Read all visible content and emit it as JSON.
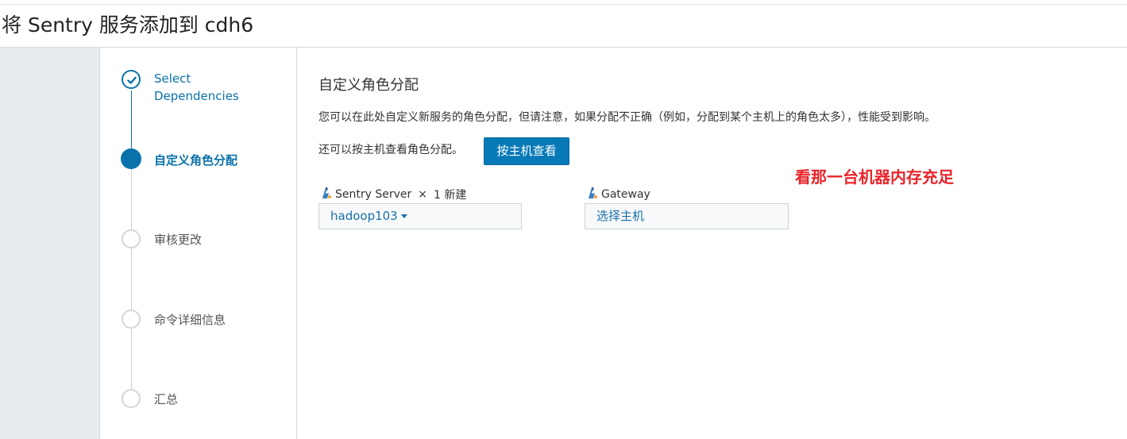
{
  "page": {
    "title": "将 Sentry 服务添加到 cdh6"
  },
  "wizard": {
    "steps": [
      {
        "label_line1": "Select",
        "label_line2": "Dependencies",
        "state": "done",
        "icon": "check-icon"
      },
      {
        "label": "自定义角色分配",
        "state": "active"
      },
      {
        "label": "审核更改",
        "state": "todo"
      },
      {
        "label": "命令详细信息",
        "state": "todo"
      },
      {
        "label": "汇总",
        "state": "todo"
      }
    ]
  },
  "main": {
    "section_title": "自定义角色分配",
    "description": "您可以在此处自定义新服务的角色分配，但请注意，如果分配不正确（例如，分配到某个主机上的角色太多），性能受到影响。",
    "host_view_hint": "还可以按主机查看角色分配。",
    "host_view_button": "按主机查看",
    "annotation": "看那一台机器内存充足",
    "roles": [
      {
        "name": "Sentry Server",
        "separator": "×",
        "count": "1 新建",
        "value": "hadoop103",
        "icon": "role-icon"
      },
      {
        "name": "Gateway",
        "value": "选择主机",
        "icon": "role-icon"
      }
    ]
  },
  "colors": {
    "accent": "#0a72aa",
    "button": "#0779b6",
    "annotation": "#e8252b"
  }
}
